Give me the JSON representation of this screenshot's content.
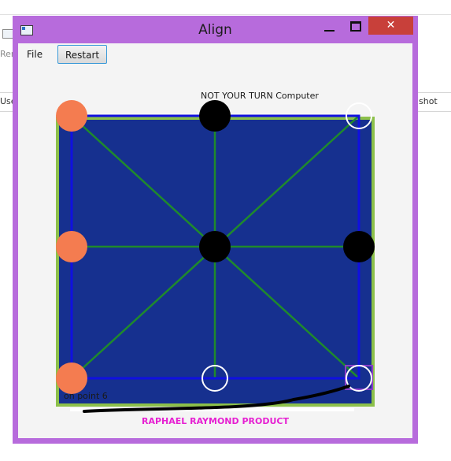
{
  "background_app": {
    "left_fragment_1": "Ren",
    "left_fragment_2": "Use",
    "right_fragment": "shot"
  },
  "window": {
    "title": "Align",
    "close_glyph": "✕",
    "colors": {
      "frame": "#b76bdc",
      "close": "#c8403a"
    }
  },
  "menu": {
    "file_label": "File",
    "restart_label": "Restart"
  },
  "game": {
    "turn_status": "NOT  YOUR TURN Computer",
    "point_status": "on point 6",
    "credit": "RAPHAEL RAYMOND PRODUCT",
    "selected_point": 6,
    "points": [
      {
        "id": 0,
        "state": "orange"
      },
      {
        "id": 1,
        "state": "black"
      },
      {
        "id": 2,
        "state": "empty"
      },
      {
        "id": 3,
        "state": "orange"
      },
      {
        "id": 4,
        "state": "black"
      },
      {
        "id": 5,
        "state": "black"
      },
      {
        "id": 6,
        "state": "orange"
      },
      {
        "id": 7,
        "state": "empty"
      },
      {
        "id": 8,
        "state": "empty"
      }
    ],
    "colors": {
      "board_border": "#8cc04a",
      "board_fill": "#16308f",
      "grid_blue": "#1010e0",
      "grid_green": "#1f8a2c",
      "orange_piece": "#f47c50",
      "black_piece": "#000000",
      "selection": "#8b3dc9",
      "credit": "#e620d2"
    }
  }
}
